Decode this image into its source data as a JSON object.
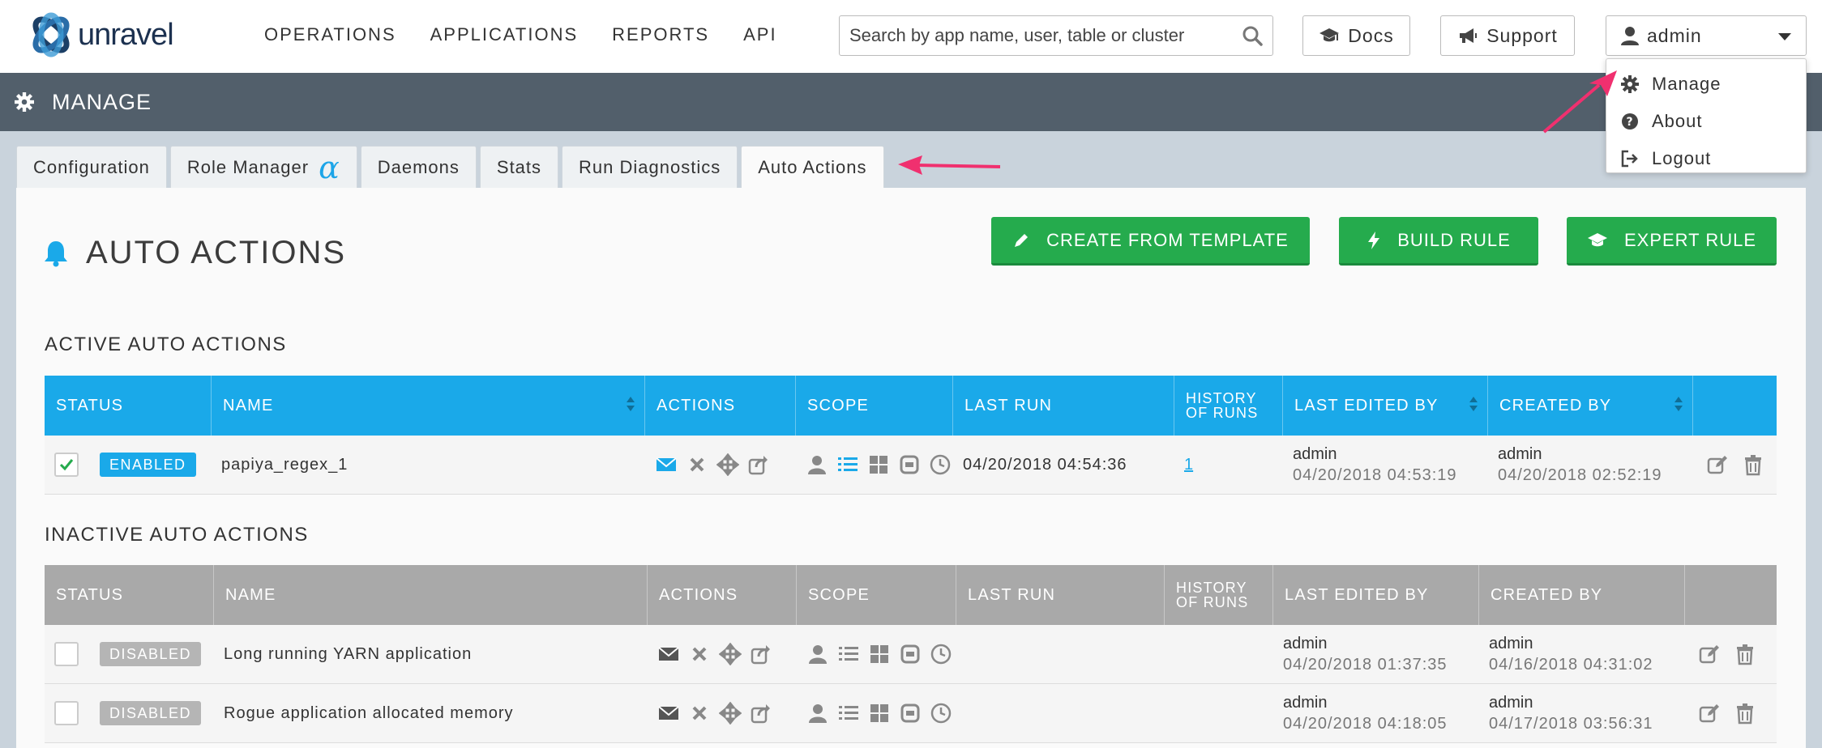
{
  "brand": {
    "name": "unravel"
  },
  "nav": [
    "OPERATIONS",
    "APPLICATIONS",
    "REPORTS",
    "API"
  ],
  "search": {
    "placeholder": "Search by app name, user, table or cluster",
    "value": ""
  },
  "header_buttons": {
    "docs": "Docs",
    "support": "Support",
    "user": "admin"
  },
  "user_menu": [
    {
      "label": "Manage",
      "icon": "gear-icon"
    },
    {
      "label": "About",
      "icon": "question-circle-icon"
    },
    {
      "label": "Logout",
      "icon": "logout-icon"
    }
  ],
  "manage_bar": {
    "title": "MANAGE"
  },
  "tabs": [
    {
      "label": "Configuration"
    },
    {
      "label": "Role Manager",
      "suffix": "α"
    },
    {
      "label": "Daemons"
    },
    {
      "label": "Stats"
    },
    {
      "label": "Run Diagnostics"
    },
    {
      "label": "Auto Actions",
      "active": true
    }
  ],
  "page": {
    "title": "AUTO ACTIONS",
    "buttons": {
      "template": "CREATE FROM TEMPLATE",
      "build": "BUILD RULE",
      "expert": "EXPERT RULE"
    }
  },
  "active": {
    "heading": "ACTIVE AUTO ACTIONS",
    "columns": [
      "STATUS",
      "NAME",
      "ACTIONS",
      "SCOPE",
      "LAST RUN",
      "HISTORY OF RUNS",
      "LAST EDITED BY",
      "CREATED BY"
    ],
    "rows": [
      {
        "checked": true,
        "status": "ENABLED",
        "name": "papiya_regex_1",
        "last_run": "04/20/2018 04:54:36",
        "history": "1",
        "edited_user": "admin",
        "edited_time": "04/20/2018 04:53:19",
        "created_user": "admin",
        "created_time": "04/20/2018 02:52:19"
      }
    ]
  },
  "inactive": {
    "heading": "INACTIVE AUTO ACTIONS",
    "columns": [
      "STATUS",
      "NAME",
      "ACTIONS",
      "SCOPE",
      "LAST RUN",
      "HISTORY OF RUNS",
      "LAST EDITED BY",
      "CREATED BY"
    ],
    "rows": [
      {
        "checked": false,
        "status": "DISABLED",
        "name": "Long running YARN application",
        "last_run": "",
        "history": "",
        "edited_user": "admin",
        "edited_time": "04/20/2018 01:37:35",
        "created_user": "admin",
        "created_time": "04/16/2018 04:31:02"
      },
      {
        "checked": false,
        "status": "DISABLED",
        "name": "Rogue application allocated memory",
        "last_run": "",
        "history": "",
        "edited_user": "admin",
        "edited_time": "04/20/2018 04:18:05",
        "created_user": "admin",
        "created_time": "04/17/2018 03:56:31"
      }
    ]
  },
  "colors": {
    "accent": "#1aa9e9",
    "green": "#25ab4d",
    "manage_bar": "#525f6b",
    "annotation_arrow": "#f0306f"
  }
}
